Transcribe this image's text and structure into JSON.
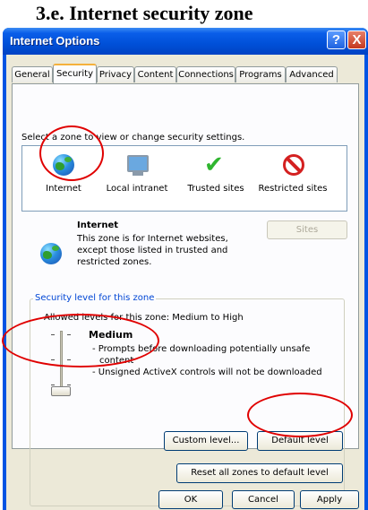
{
  "heading": "3.e. Internet security zone",
  "window": {
    "title": "Internet Options",
    "help_label": "?",
    "close_label": "X"
  },
  "tabs": [
    "General",
    "Security",
    "Privacy",
    "Content",
    "Connections",
    "Programs",
    "Advanced"
  ],
  "active_tab": "Security",
  "zones": {
    "instruction": "Select a zone to view or change security settings.",
    "items": [
      "Internet",
      "Local intranet",
      "Trusted sites",
      "Restricted sites"
    ],
    "selected": "Internet"
  },
  "zone_info": {
    "title": "Internet",
    "description": "This zone is for Internet websites, except those listed in trusted and restricted zones.",
    "sites_label": "Sites"
  },
  "security_level": {
    "group_label": "Security level for this zone",
    "allowed": "Allowed levels for this zone: Medium to High",
    "level": "Medium",
    "desc_line1": "- Prompts before downloading potentially unsafe",
    "desc_line2": "content",
    "desc_line3": "- Unsigned ActiveX controls will not be downloaded",
    "custom_label": "Custom level...",
    "default_label": "Default level"
  },
  "reset_label": "Reset all zones to default level",
  "dialog_buttons": {
    "ok": "OK",
    "cancel": "Cancel",
    "apply": "Apply"
  },
  "colors": {
    "titlebar": "#0054e3",
    "annotation": "#e00000",
    "active_tab_accent": "#f5b13b"
  }
}
